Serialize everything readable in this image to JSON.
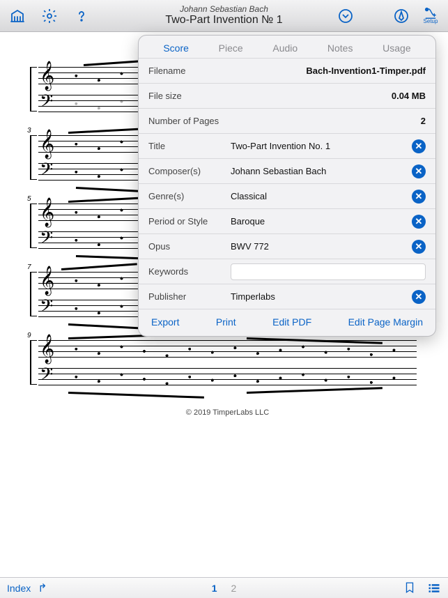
{
  "header": {
    "composer": "Johann Sebastian Bach",
    "title": "Two-Part Invention № 1",
    "setup_label": "Setup"
  },
  "popover": {
    "tabs": [
      "Score",
      "Piece",
      "Audio",
      "Notes",
      "Usage"
    ],
    "active_tab": 0,
    "rows": {
      "filename_label": "Filename",
      "filename_value": "Bach-Invention1-Timper.pdf",
      "filesize_label": "File size",
      "filesize_value": "0.04 MB",
      "pages_label": "Number of Pages",
      "pages_value": "2",
      "title_label": "Title",
      "title_value": "Two-Part Invention No. 1",
      "composer_label": "Composer(s)",
      "composer_value": "Johann Sebastian Bach",
      "genre_label": "Genre(s)",
      "genre_value": "Classical",
      "period_label": "Period or Style",
      "period_value": "Baroque",
      "opus_label": "Opus",
      "opus_value": "BWV 772",
      "keywords_label": "Keywords",
      "keywords_value": "",
      "publisher_label": "Publisher",
      "publisher_value": "Timperlabs"
    },
    "actions": {
      "export": "Export",
      "print": "Print",
      "edit_pdf": "Edit PDF",
      "edit_margin": "Edit Page Margin"
    }
  },
  "score": {
    "measure_numbers": [
      "3",
      "5",
      "7",
      "9"
    ],
    "copyright": "© 2019 TimperLabs LLC"
  },
  "bottombar": {
    "index_label": "Index",
    "pages": [
      "1",
      "2"
    ],
    "active_page": 0
  }
}
